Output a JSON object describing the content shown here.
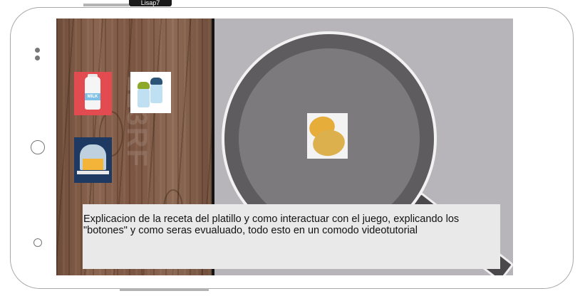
{
  "device": {
    "top_tab_label": "Lisap7"
  },
  "game": {
    "ingredients": [
      {
        "name": "milk-bottle",
        "label": "MILK",
        "color": "#e24b4f"
      },
      {
        "name": "salt-pepper-shakers",
        "color": "#ffffff"
      },
      {
        "name": "butter-dish",
        "color": "#1e3a62"
      }
    ],
    "pan_item": {
      "name": "potatoes",
      "color": "#ddb04e"
    },
    "watermark": "123RF"
  },
  "instructions": {
    "text": "Explicacion de la receta del platillo y como interactuar con el juego, explicando los \"botones\" y como seras evualuado, todo esto en un comodo videotutorial"
  },
  "colors": {
    "wood": "#7c5643",
    "stove": "#b7b5ba",
    "pan": "#5f5c60",
    "info_box": "#e9e9e9"
  }
}
